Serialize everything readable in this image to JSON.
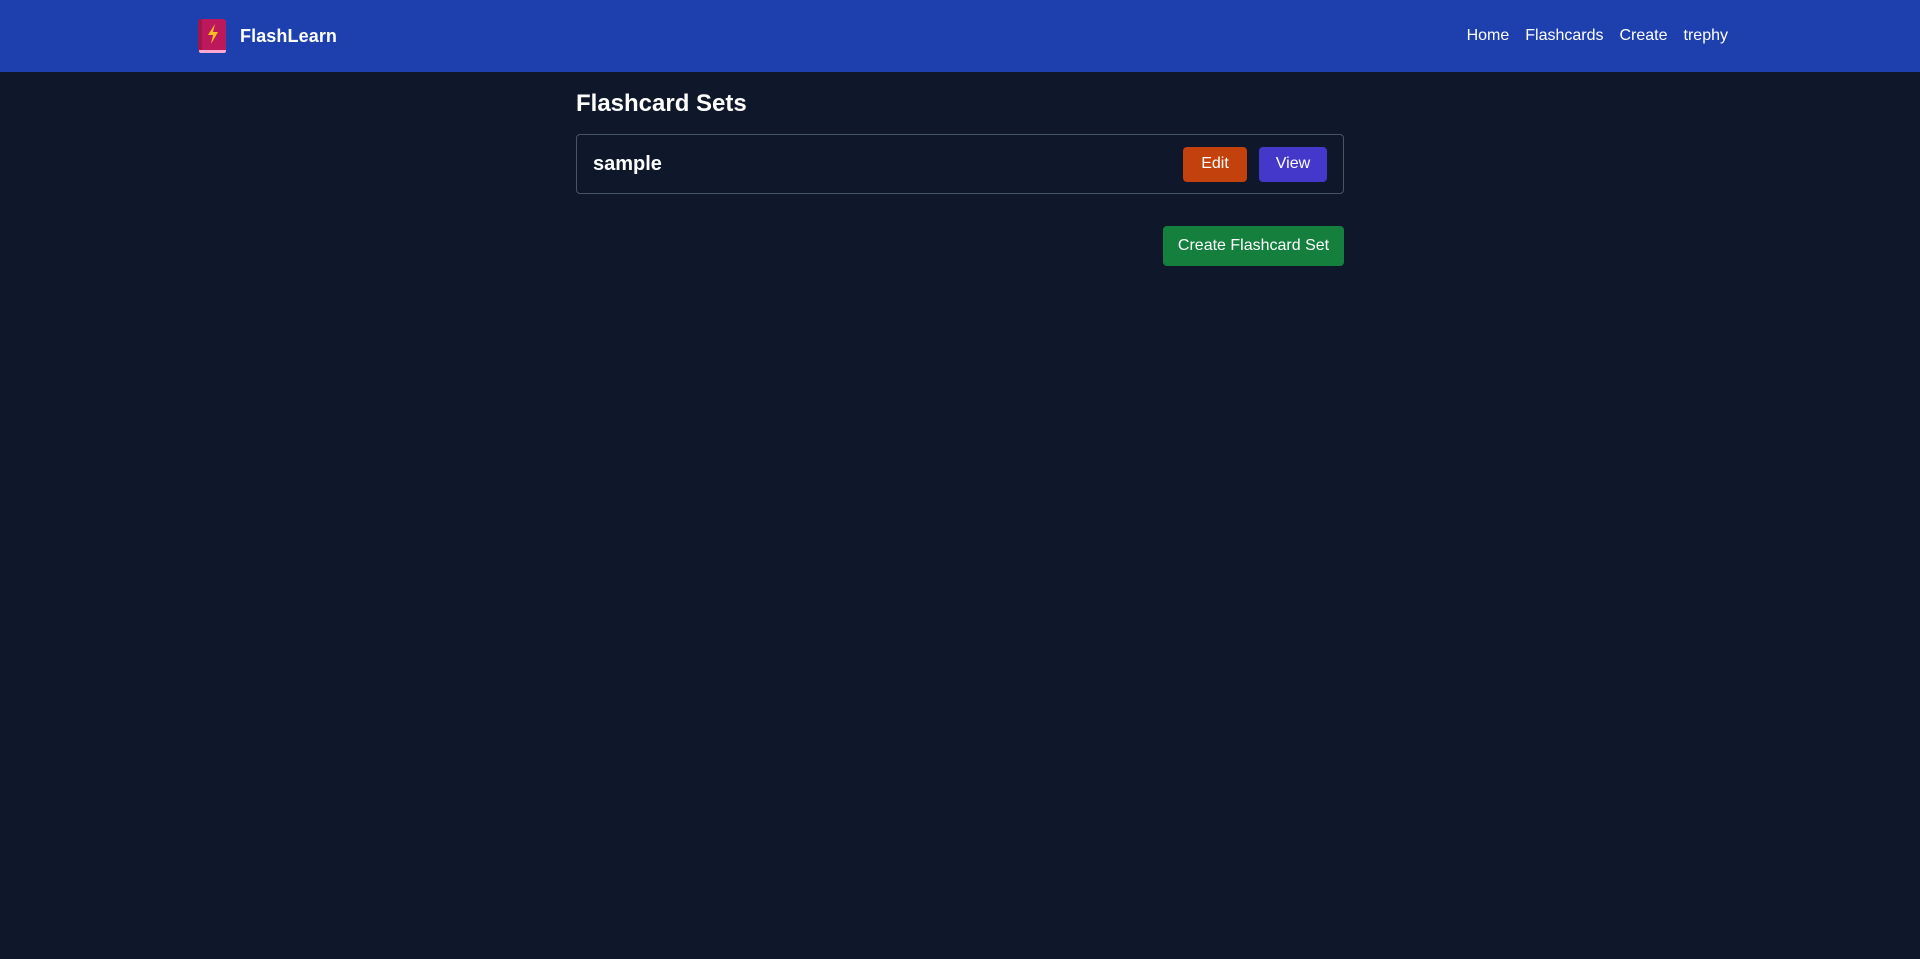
{
  "navbar": {
    "brand_name": "FlashLearn",
    "logo_icon": "book-lightning-icon",
    "links": [
      {
        "label": "Home"
      },
      {
        "label": "Flashcards"
      },
      {
        "label": "Create"
      },
      {
        "label": "trephy"
      }
    ]
  },
  "main": {
    "title": "Flashcard Sets",
    "sets": [
      {
        "name": "sample",
        "edit_label": "Edit",
        "view_label": "View"
      }
    ],
    "create_button_label": "Create Flashcard Set"
  },
  "colors": {
    "navbar_bg": "#1e40af",
    "page_bg": "#0f172a",
    "edit_button": "#c2410c",
    "view_button": "#4338ca",
    "create_button": "#15803d",
    "card_border": "#475569"
  }
}
